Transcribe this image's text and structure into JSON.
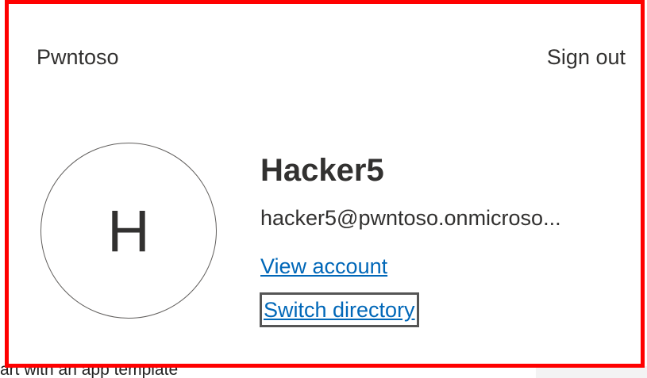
{
  "background": {
    "partial_text": "art with an app template"
  },
  "flyout": {
    "org_name": "Pwntoso",
    "sign_out_label": "Sign out",
    "avatar_initial": "H",
    "user_name": "Hacker5",
    "user_email": "hacker5@pwntoso.onmicroso...",
    "view_account_label": "View account",
    "switch_directory_label": "Switch directory"
  },
  "colors": {
    "highlight_border": "#ff0000",
    "link": "#0067b8",
    "text": "#323130",
    "focus_outline": "#555555"
  }
}
